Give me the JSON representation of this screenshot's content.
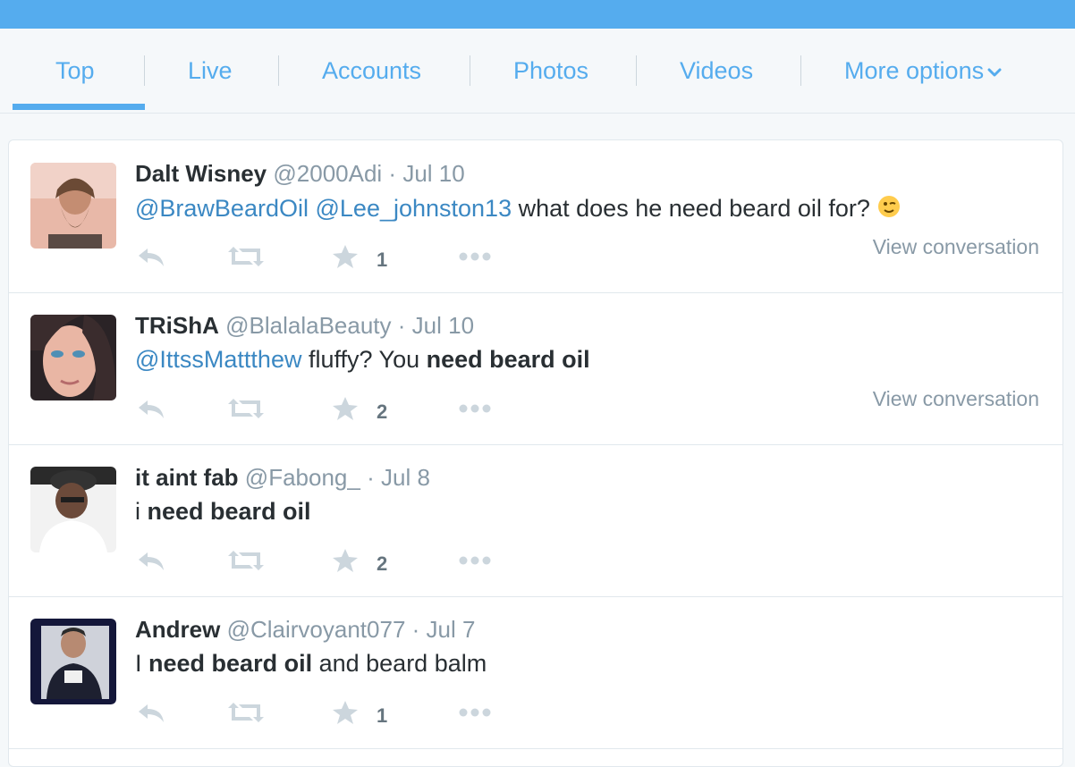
{
  "tabs": [
    {
      "label": "Top"
    },
    {
      "label": "Live"
    },
    {
      "label": "Accounts"
    },
    {
      "label": "Photos"
    },
    {
      "label": "Videos"
    },
    {
      "label": "More options"
    }
  ],
  "colors": {
    "brand": "#55acee",
    "mention": "#3b88c3",
    "muted": "#8899a6",
    "text": "#292f33"
  },
  "tweets": [
    {
      "name": "Dalt Wisney",
      "handle": "@2000Adi",
      "dot": "·",
      "time": "Jul 10",
      "mention1": "@BrawBeardOil",
      "mention2": "@Lee_johnston13",
      "text": "what does he need beard oil for?",
      "emoji": "winking-face-icon",
      "likes": "1",
      "view": "View conversation"
    },
    {
      "name": "TRiShA",
      "handle": "@BlalalaBeauty",
      "dot": "·",
      "time": "Jul 10",
      "mention1": "@IttssMattthew",
      "text": "fluffy? You",
      "bold": "need beard oil",
      "likes": "2",
      "view": "View conversation"
    },
    {
      "name": "it aint fab",
      "handle": "@Fabong_",
      "dot": "·",
      "time": "Jul 8",
      "pre": "i",
      "bold": "need beard oil",
      "likes": "2"
    },
    {
      "name": "Andrew",
      "handle": "@Clairvoyant077",
      "dot": "·",
      "time": "Jul 7",
      "pre": "I",
      "bold": "need beard oil",
      "post": "and beard balm",
      "likes": "1"
    }
  ]
}
